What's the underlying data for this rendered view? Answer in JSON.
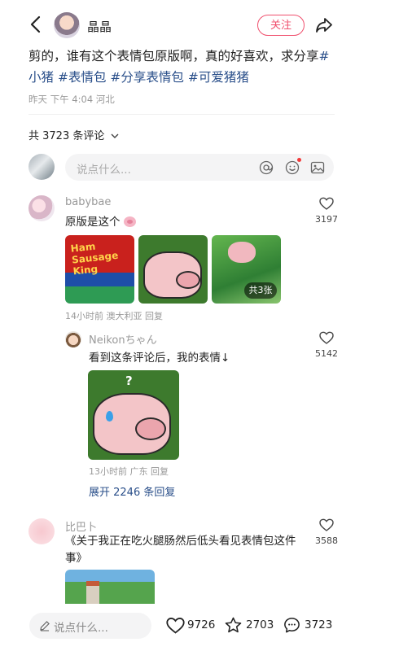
{
  "header": {
    "author": "晶晶",
    "follow_label": "关注"
  },
  "post": {
    "text": "剪的，谁有这个表情包原版啊，真的好喜欢，求分享",
    "tags": [
      "#小猪",
      "#表情包",
      "#分享表情包",
      "#可爱猪猪"
    ],
    "meta": "昨天 下午 4:04 河北"
  },
  "comments_header": {
    "count_label": "共 3723 条评论"
  },
  "comment_input": {
    "placeholder": "说点什么..."
  },
  "comments": [
    {
      "name": "babybae",
      "text": "原版是这个",
      "likes": "3197",
      "meta": "14小时前 澳大利亚 回复",
      "image_text": "Ham Sausage King",
      "more_images": "共3张"
    },
    {
      "name": "Neikonちゃん",
      "text": "看到这条评论后，我的表情↓",
      "likes": "5142",
      "meta": "13小时前 广东 回复",
      "image_mark": "?",
      "expand": "展开 2246 条回复"
    },
    {
      "name": "比巴卜",
      "text": "《关于我正在吃火腿肠然后低头看见表情包这件事》",
      "likes": "3588"
    }
  ],
  "bottom_bar": {
    "placeholder": "说点什么...",
    "likes": "9726",
    "favorites": "2703",
    "comments": "3723"
  },
  "colors": {
    "accent": "#f0506e",
    "tag": "#2a4f8a",
    "muted": "#999999"
  }
}
